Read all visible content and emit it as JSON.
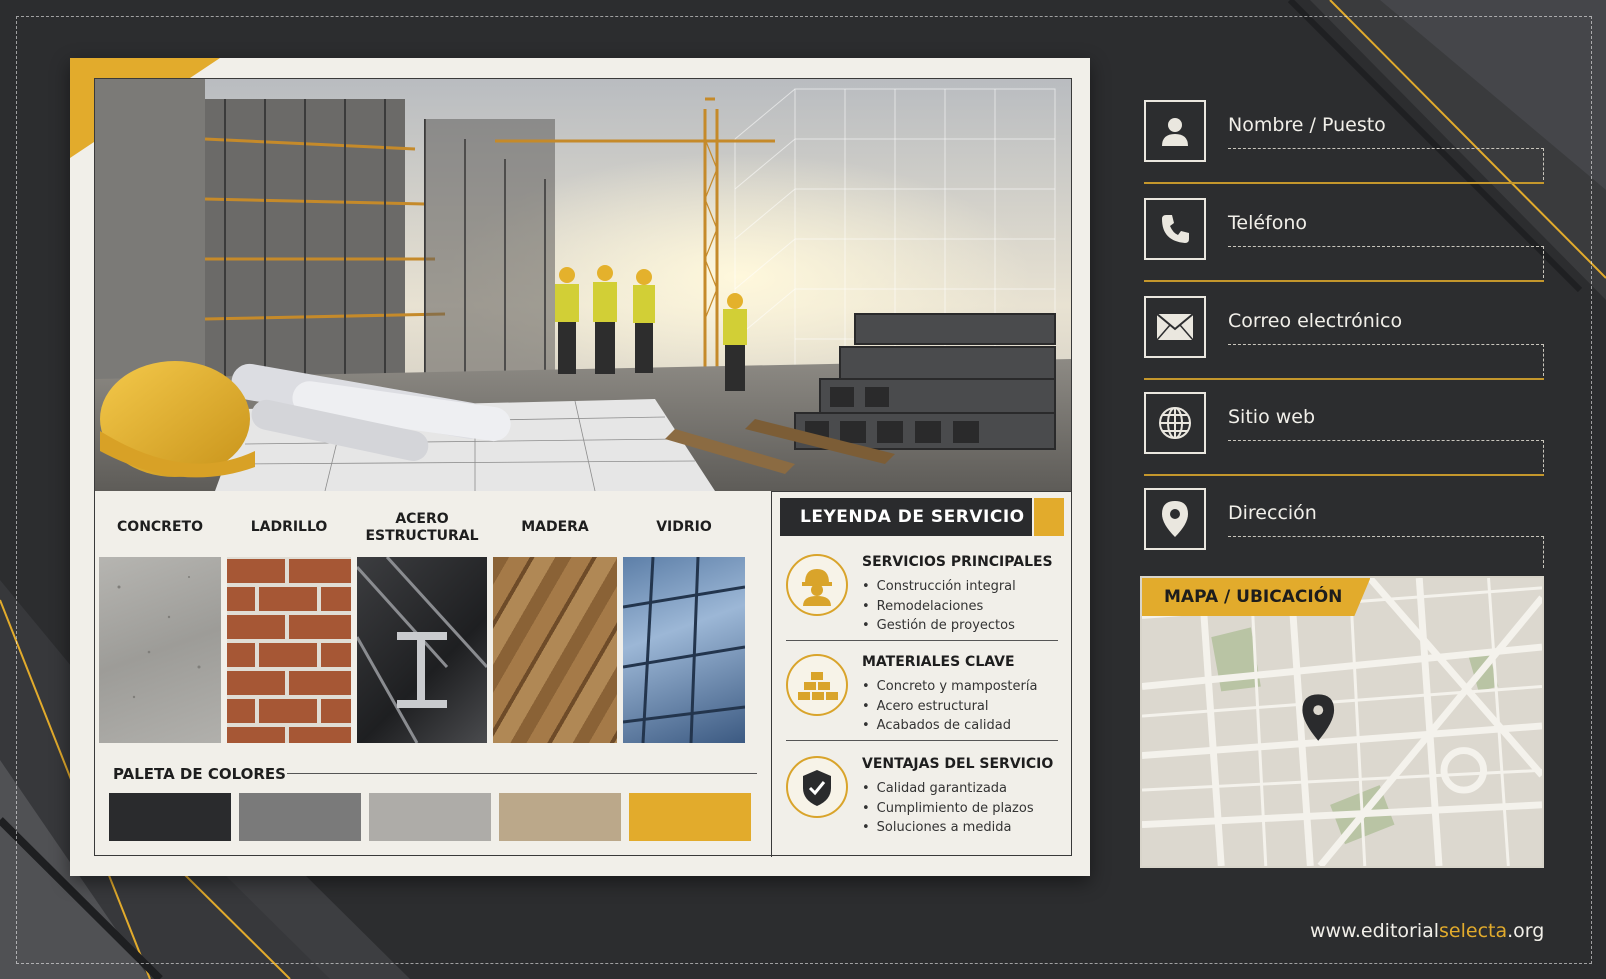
{
  "materials": [
    {
      "label": "CONCRETO",
      "name": "concreto"
    },
    {
      "label": "LADRILLO",
      "name": "ladrillo"
    },
    {
      "label": "ACERO\nESTRUCTURAL",
      "name": "acero-estructural"
    },
    {
      "label": "MADERA",
      "name": "madera"
    },
    {
      "label": "VIDRIO",
      "name": "vidrio"
    }
  ],
  "palette": {
    "title": "PALETA DE COLORES",
    "colors": [
      "#2a2b2d",
      "#7a7a7a",
      "#aeaca8",
      "#bba88a",
      "#e2ab2c"
    ]
  },
  "legend": {
    "title": "LEYENDA DE SERVICIO",
    "sections": [
      {
        "title": "SERVICIOS PRINCIPALES",
        "icon": "worker-icon",
        "items": [
          "Construcción integral",
          "Remodelaciones",
          "Gestión de proyectos"
        ]
      },
      {
        "title": "MATERIALES CLAVE",
        "icon": "bricks-icon",
        "items": [
          "Concreto y mampostería",
          "Acero estructural",
          "Acabados de calidad"
        ]
      },
      {
        "title": "VENTAJAS DEL SERVICIO",
        "icon": "shield-check-icon",
        "items": [
          "Calidad garantizada",
          "Cumplimiento de plazos",
          "Soluciones a medida"
        ]
      }
    ]
  },
  "contact": [
    {
      "label": "Nombre / Puesto",
      "icon": "person-icon"
    },
    {
      "label": "Teléfono",
      "icon": "phone-icon"
    },
    {
      "label": "Correo electrónico",
      "icon": "mail-icon"
    },
    {
      "label": "Sitio web",
      "icon": "globe-icon"
    },
    {
      "label": "Dirección",
      "icon": "location-pin-icon"
    }
  ],
  "map": {
    "title": "MAPA / UBICACIÓN"
  },
  "website": {
    "prefix": "www.editorial",
    "highlight": "selecta",
    "suffix": ".org"
  },
  "colors": {
    "accent": "#e2ab2c",
    "dark": "#2c2d2f",
    "paper": "#f1efe9"
  }
}
